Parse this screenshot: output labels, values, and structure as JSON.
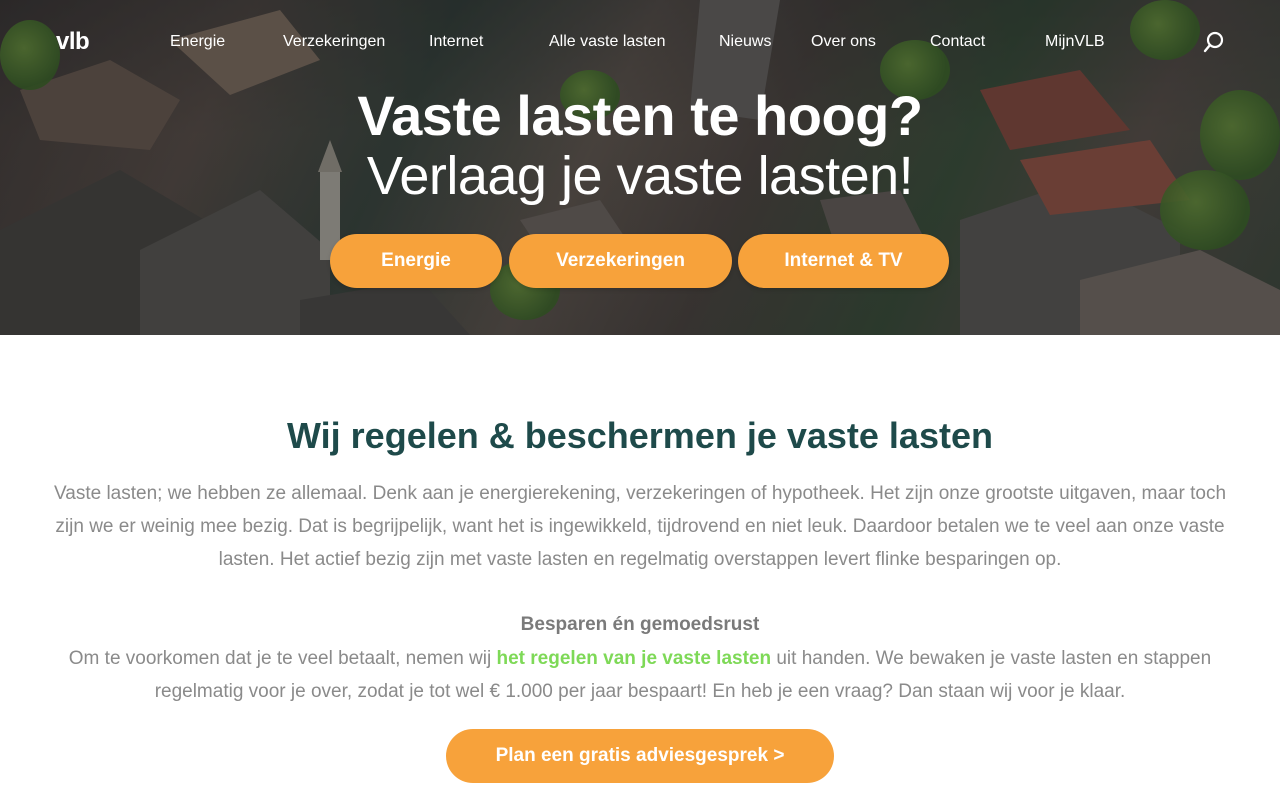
{
  "brand": {
    "logo_text": "vlb",
    "accent": "#f7a23b",
    "heading_color": "#1e4a4a",
    "link_color": "#7ed957"
  },
  "nav": {
    "items": [
      {
        "label": "Energie"
      },
      {
        "label": "Verzekeringen"
      },
      {
        "label": "Internet"
      },
      {
        "label": "Alle vaste lasten"
      },
      {
        "label": "Nieuws"
      },
      {
        "label": "Over ons"
      },
      {
        "label": "Contact"
      },
      {
        "label": "MijnVLB"
      }
    ],
    "search_icon": "search-icon"
  },
  "hero": {
    "title": "Vaste lasten te hoog?",
    "subtitle": "Verlaag je vaste lasten!",
    "buttons": [
      {
        "label": "Energie"
      },
      {
        "label": "Verzekeringen"
      },
      {
        "label": "Internet & TV"
      }
    ]
  },
  "main": {
    "title": "Wij regelen & beschermen je vaste lasten",
    "intro": "Vaste lasten; we hebben ze allemaal. Denk aan je energierekening, verzekeringen of hypotheek. Het zijn onze grootste uitgaven, maar toch zijn we er weinig mee bezig. Dat is begrijpelijk, want het is ingewikkeld, tijdrovend en niet leuk. Daardoor betalen we te veel aan onze vaste lasten. Het actief bezig zijn met vaste lasten en regelmatig overstappen levert flinke besparingen op.",
    "subheading": "Besparen én gemoedsrust",
    "para2_before": "Om te voorkomen dat je te veel betaalt, nemen wij ",
    "para2_link": "het regelen van je vaste lasten",
    "para2_after": " uit handen. We bewaken je vaste lasten en stappen regelmatig voor je over, zodat je tot wel € 1.000 per jaar bespaart! En heb je een vraag? Dan staan wij voor je klaar.",
    "cta": "Plan een gratis adviesgesprek >"
  }
}
